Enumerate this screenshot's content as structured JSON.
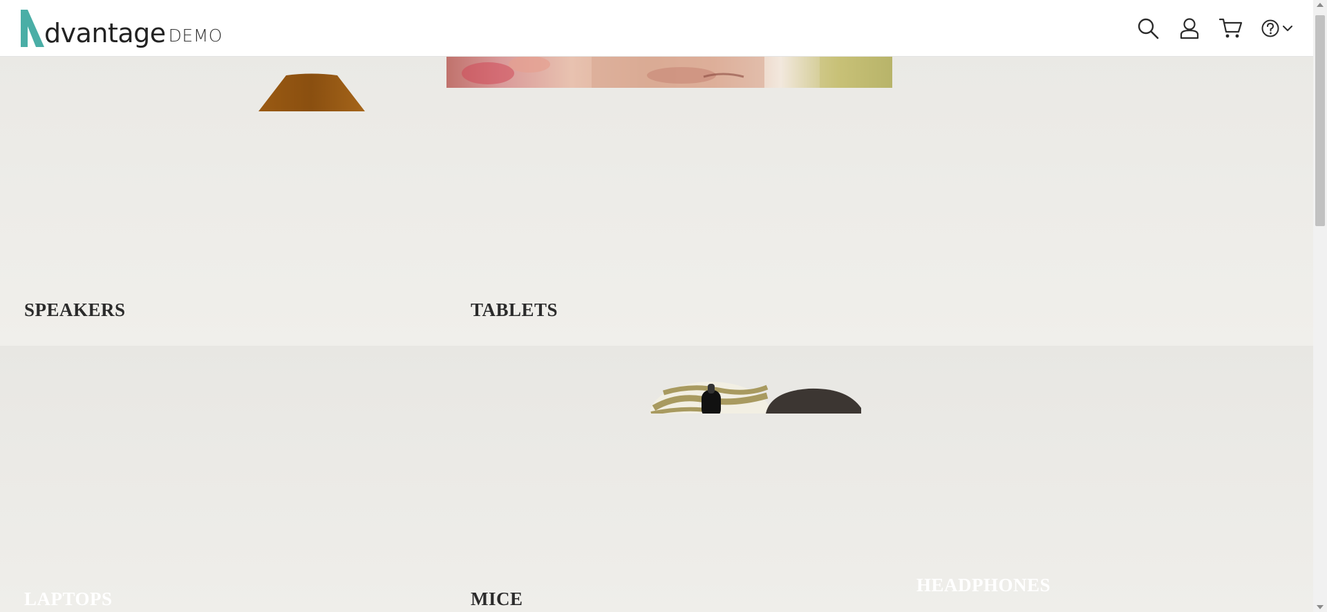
{
  "header": {
    "logo": {
      "word": "dvantage",
      "suffix": "DEMO"
    },
    "icons": [
      "search-icon",
      "user-icon",
      "cart-icon",
      "help-icon",
      "chevron-down-icon"
    ]
  },
  "categories": [
    {
      "label": "SPEAKERS"
    },
    {
      "label": "TABLETS"
    },
    {
      "label": "LAPTOPS"
    },
    {
      "label": "MICE"
    },
    {
      "label": "HEADPHONES"
    }
  ],
  "colors": {
    "logo_teal": "#4aaea6",
    "text_dark": "#2b2b2b",
    "speaker_brown": "#9a5a12"
  }
}
